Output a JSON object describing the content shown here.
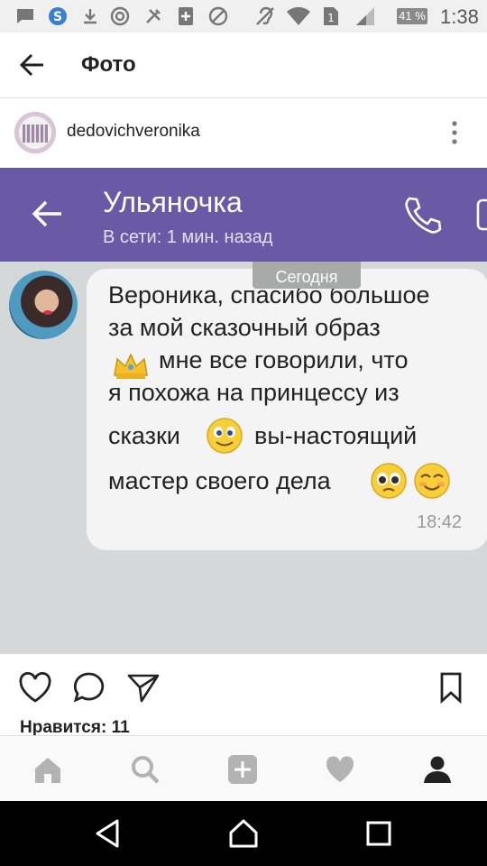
{
  "status_bar": {
    "battery": "41 %",
    "time": "1:38"
  },
  "header": {
    "title": "Фото"
  },
  "post": {
    "username": "dedovichveronika",
    "likes": "Нравится: 11"
  },
  "chat": {
    "contact_name": "Ульяночка",
    "contact_status": "В сети: 1 мин. назад",
    "date_label": "Сегодня",
    "message_lines": [
      "Вероника, спасибо большое",
      "за мой сказочный образ",
      "мне все говорили, что",
      "я похожа на принцессу из",
      "сказки",
      "вы-настоящий",
      "мастер своего дела"
    ],
    "message_time": "18:42"
  },
  "colors": {
    "viber_bar": "#6a5aa6",
    "chat_bg": "#d5d8d8",
    "bubble": "#f4f4f4"
  },
  "icons": {
    "status": [
      "message-icon",
      "skype-icon",
      "download-icon",
      "at-icon",
      "tools-icon",
      "plus-box-icon",
      "block-icon",
      "hearing-icon",
      "wifi-icon",
      "sim-icon",
      "signal-icon"
    ],
    "tabs": [
      "home-icon",
      "search-icon",
      "add-icon",
      "heart-icon",
      "profile-icon"
    ],
    "nav": [
      "back-triangle-icon",
      "home-circle-icon",
      "recents-square-icon"
    ]
  }
}
